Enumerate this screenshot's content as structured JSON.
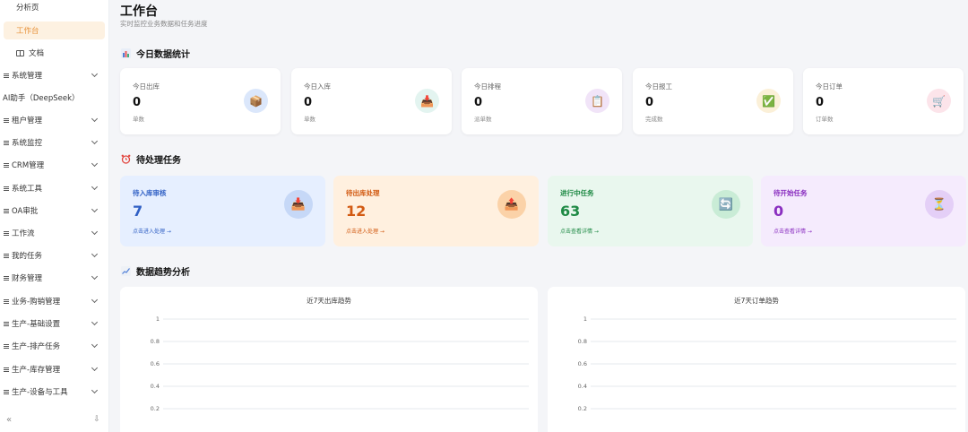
{
  "sidebar": {
    "items": [
      {
        "label": "分析页",
        "type": "sub"
      },
      {
        "label": "工作台",
        "type": "active"
      },
      {
        "label": "文档",
        "type": "doc"
      },
      {
        "label": "系统管理",
        "type": "group"
      },
      {
        "label": "AI助手（DeepSeek）",
        "type": "plain"
      },
      {
        "label": "租户管理",
        "type": "group"
      },
      {
        "label": "系统监控",
        "type": "group"
      },
      {
        "label": "CRM管理",
        "type": "group"
      },
      {
        "label": "系统工具",
        "type": "group"
      },
      {
        "label": "OA审批",
        "type": "group"
      },
      {
        "label": "工作流",
        "type": "group"
      },
      {
        "label": "我的任务",
        "type": "group"
      },
      {
        "label": "财务管理",
        "type": "group"
      },
      {
        "label": "业务-购销管理",
        "type": "group"
      },
      {
        "label": "生产-基础设置",
        "type": "group"
      },
      {
        "label": "生产-排产任务",
        "type": "group"
      },
      {
        "label": "生产-库存管理",
        "type": "group"
      },
      {
        "label": "生产-设备与工具",
        "type": "group"
      }
    ],
    "collapse_glyph": "«",
    "pin_glyph": "⇩"
  },
  "header": {
    "title": "工作台",
    "subtitle": "实时监控业务数据和任务进度"
  },
  "sections": {
    "stats": "今日数据统计",
    "tasks": "待处理任务",
    "trends": "数据趋势分析"
  },
  "stats": [
    {
      "label": "今日出库",
      "value": "0",
      "unit": "单数",
      "icon": "box-icon",
      "glyph": "📦",
      "bg": "#dbe7fb"
    },
    {
      "label": "今日入库",
      "value": "0",
      "unit": "单数",
      "icon": "inbox-icon",
      "glyph": "📥",
      "bg": "#e3f4f0"
    },
    {
      "label": "今日排程",
      "value": "0",
      "unit": "派单数",
      "icon": "clipboard-icon",
      "glyph": "📋",
      "bg": "#f1e4f8"
    },
    {
      "label": "今日报工",
      "value": "0",
      "unit": "完成数",
      "icon": "check-icon",
      "glyph": "✅",
      "bg": "#fbf0d8"
    },
    {
      "label": "今日订单",
      "value": "0",
      "unit": "订单数",
      "icon": "cart-icon",
      "glyph": "🛒",
      "bg": "#fce4ea"
    }
  ],
  "tasks": [
    {
      "label": "待入库审核",
      "value": "7",
      "link": "点击进入处理 →",
      "icon": "inbox-icon",
      "glyph": "📥",
      "color": "#2f5fc4",
      "bg": "#e6efff",
      "icon_bg": "#c6d8f7"
    },
    {
      "label": "待出库处理",
      "value": "12",
      "link": "点击进入处理 →",
      "icon": "outbox-icon",
      "glyph": "📤",
      "color": "#d25a12",
      "bg": "#fff0df",
      "icon_bg": "#fbd2a8"
    },
    {
      "label": "进行中任务",
      "value": "63",
      "link": "点击查看详情 →",
      "icon": "refresh-icon",
      "glyph": "🔄",
      "color": "#1f8a45",
      "bg": "#e9f7ee",
      "icon_bg": "#c9ecd6"
    },
    {
      "label": "待开始任务",
      "value": "0",
      "link": "点击查看详情 →",
      "icon": "hourglass-icon",
      "glyph": "⏳",
      "color": "#8a2fc0",
      "bg": "#f5ebfd",
      "icon_bg": "#e4cff7"
    }
  ],
  "chart_data": [
    {
      "type": "line",
      "title": "近7天出库趋势",
      "y_ticks": [
        "1",
        "0.8",
        "0.6",
        "0.4",
        "0.2"
      ],
      "ylim": [
        0,
        1
      ],
      "grid": true,
      "series": []
    },
    {
      "type": "line",
      "title": "近7天订单趋势",
      "y_ticks": [
        "1",
        "0.8",
        "0.6",
        "0.4",
        "0.2"
      ],
      "ylim": [
        0,
        1
      ],
      "grid": true,
      "series": []
    }
  ]
}
